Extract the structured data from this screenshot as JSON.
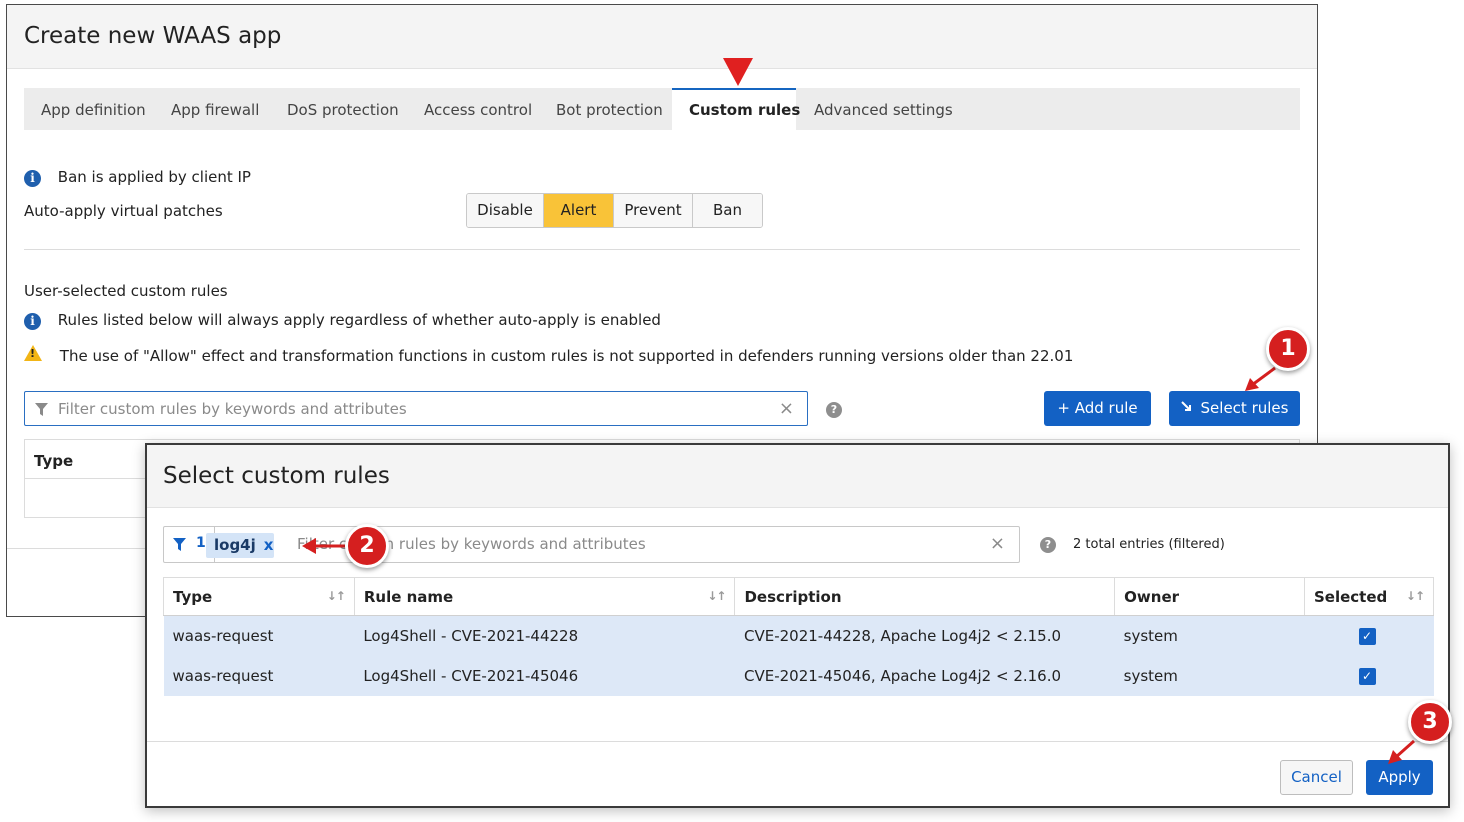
{
  "window": {
    "title": "Create new WAAS app"
  },
  "tabs": [
    {
      "label": "App definition"
    },
    {
      "label": "App firewall"
    },
    {
      "label": "DoS protection"
    },
    {
      "label": "Access control"
    },
    {
      "label": "Bot protection"
    },
    {
      "label": "Custom rules",
      "active": true
    },
    {
      "label": "Advanced settings"
    }
  ],
  "ban_info": "Ban is applied by client IP",
  "auto_apply": {
    "label": "Auto-apply virtual patches",
    "options": [
      "Disable",
      "Alert",
      "Prevent",
      "Ban"
    ],
    "selected": "Alert"
  },
  "user_rules": {
    "heading": "User-selected custom rules",
    "info": "Rules listed below will always apply regardless of whether auto-apply is enabled",
    "warning": "The use of \"Allow\" effect and transformation functions in custom rules is not supported in defenders running versions older than 22.01",
    "filter_placeholder": "Filter custom rules by keywords and attributes",
    "clear": "×",
    "help": "?",
    "add_rule": "+ Add rule",
    "select_rules": "Select rules",
    "table_header_type": "Type"
  },
  "modal": {
    "title": "Select custom rules",
    "filter_count": "1",
    "chip": "log4j",
    "chip_remove": "x",
    "filter_placeholder": "Filter custom rules by keywords and attributes",
    "clear": "×",
    "help": "?",
    "total": "2 total entries (filtered)",
    "columns": [
      "Type",
      "Rule name",
      "Description",
      "Owner",
      "Selected"
    ],
    "rows": [
      {
        "type": "waas-request",
        "name": "Log4Shell - CVE-2021-44228",
        "description": "CVE-2021-44228, Apache Log4j2 < 2.15.0",
        "owner": "system",
        "selected": true
      },
      {
        "type": "waas-request",
        "name": "Log4Shell - CVE-2021-45046",
        "description": "CVE-2021-45046, Apache Log4j2 < 2.16.0",
        "owner": "system",
        "selected": true
      }
    ],
    "cancel": "Cancel",
    "apply": "Apply"
  },
  "annotations": [
    "1",
    "2",
    "3"
  ],
  "colors": {
    "accent": "#1361c4",
    "alert": "#f9c338",
    "annotation": "#d51f1f",
    "row_selected": "#dde8f7"
  }
}
